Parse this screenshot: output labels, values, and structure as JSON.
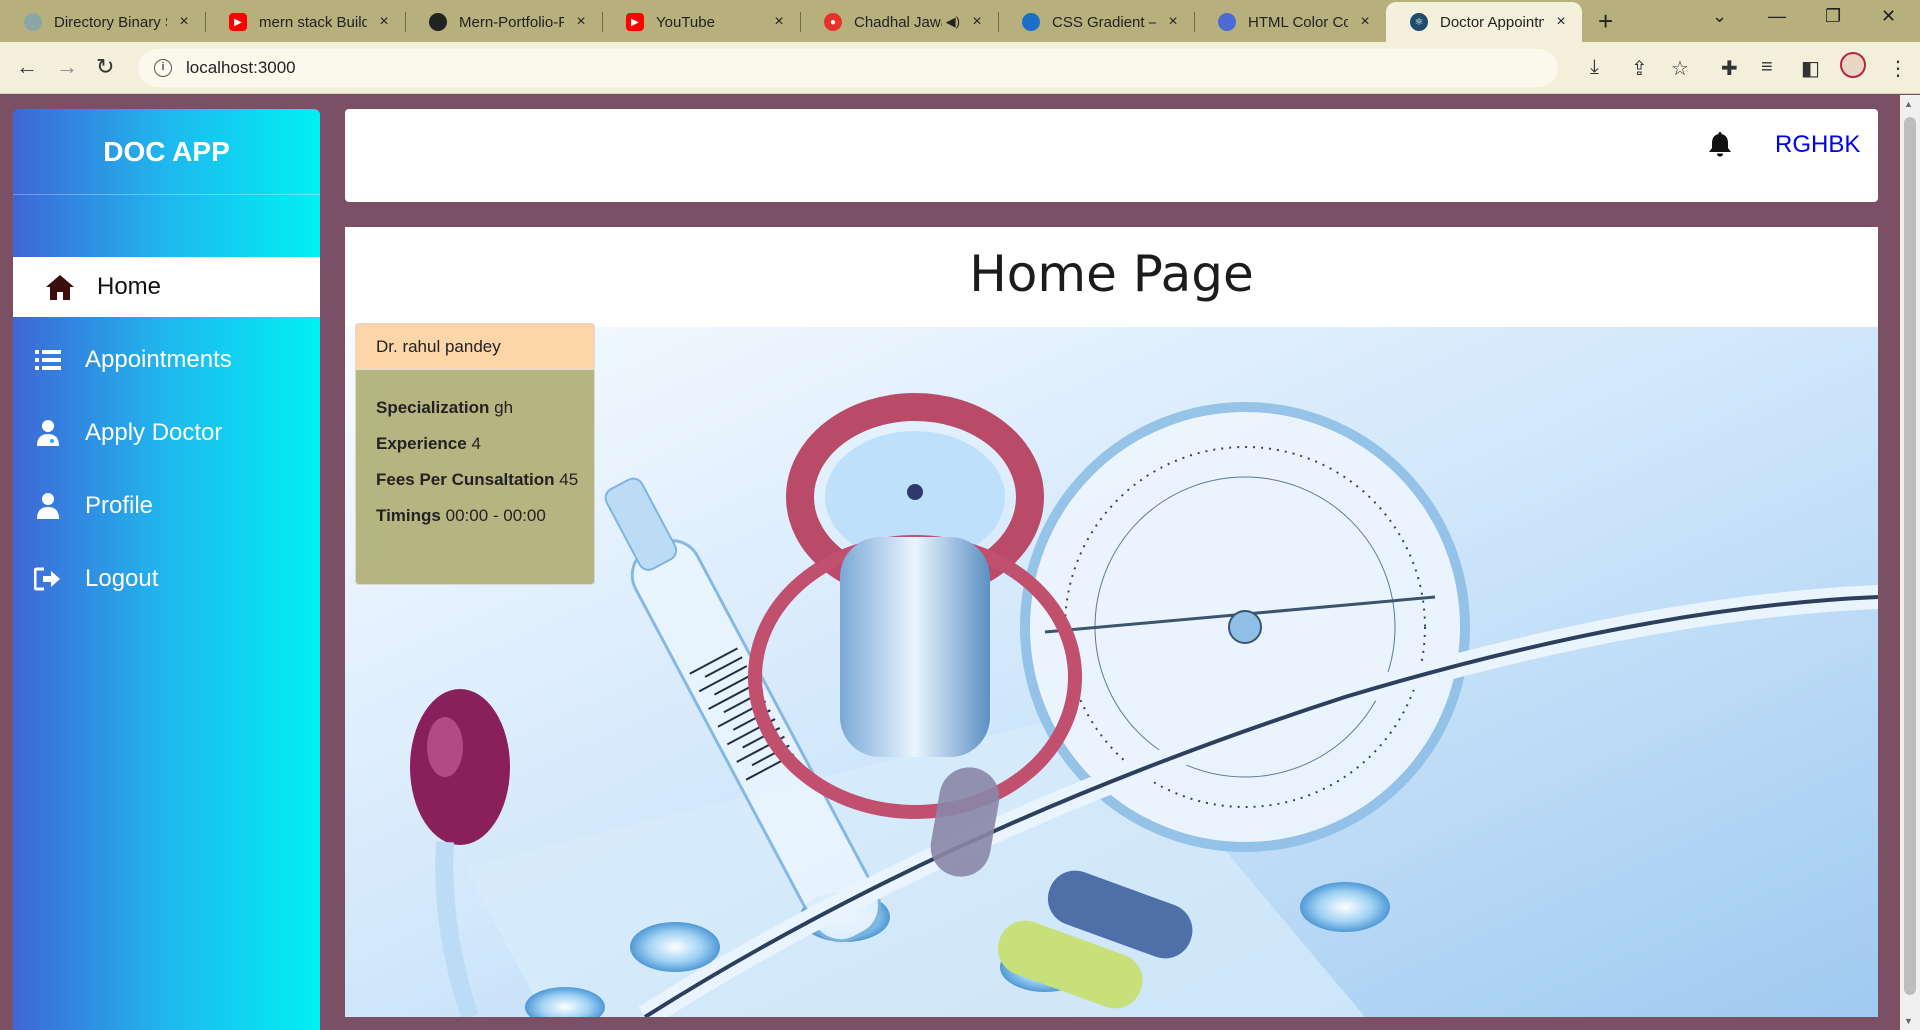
{
  "browser": {
    "tabs": [
      {
        "title": "Directory Binary S",
        "favicon_color": "#8aa7a7",
        "close": "×"
      },
      {
        "title": "mern stack Buildin",
        "favicon_color": "#ff0000",
        "close": "×"
      },
      {
        "title": "Mern-Portfolio-P",
        "favicon_color": "#222222",
        "close": "×"
      },
      {
        "title": "YouTube",
        "favicon_color": "#ff0000",
        "close": "×"
      },
      {
        "title": "Chadhal Jawa",
        "favicon_color": "#e5322d",
        "close": "×"
      },
      {
        "title": "CSS Gradient — C",
        "favicon_color": "#1a6fc9",
        "close": "×"
      },
      {
        "title": "HTML Color Code",
        "favicon_color": "#4a6bd1",
        "close": "×"
      },
      {
        "title": "Doctor Appointm",
        "favicon_color": "#1d4d6b",
        "close": "×"
      }
    ],
    "new_tab": "+",
    "url": "localhost:3000"
  },
  "app": {
    "logo": "DOC APP",
    "menu": [
      {
        "label": "Home",
        "icon": "home-icon"
      },
      {
        "label": "Appointments",
        "icon": "list-icon"
      },
      {
        "label": "Apply Doctor",
        "icon": "user-doctor-icon"
      },
      {
        "label": "Profile",
        "icon": "user-icon"
      },
      {
        "label": "Logout",
        "icon": "logout-icon"
      }
    ],
    "header": {
      "username": "RGHBK"
    },
    "page_title": "Home Page",
    "doctor_card": {
      "name": "Dr. rahul pandey",
      "specialization_label": "Specialization",
      "specialization": "gh",
      "experience_label": "Experience",
      "experience": "4",
      "fees_label": "Fees Per Cunsaltation",
      "fees": "45",
      "timings_label": "Timings",
      "timings": "00:00 - 00:00"
    }
  }
}
